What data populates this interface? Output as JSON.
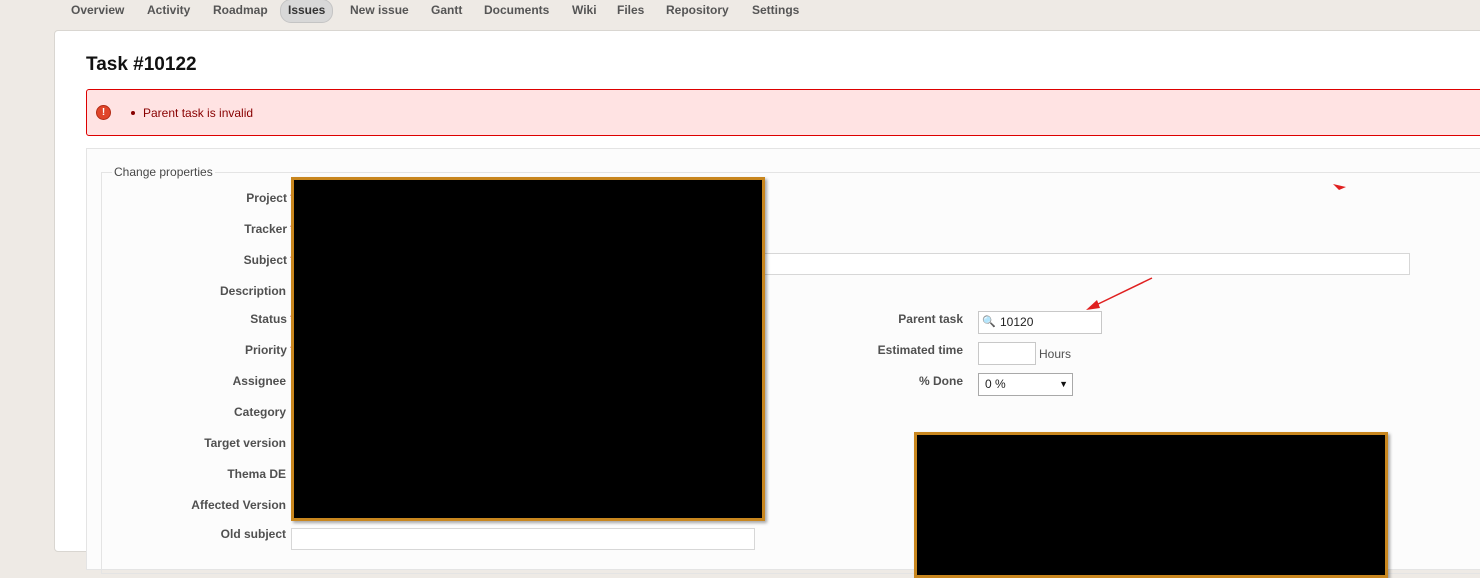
{
  "tabs": [
    {
      "label": "Overview"
    },
    {
      "label": "Activity"
    },
    {
      "label": "Roadmap"
    },
    {
      "label": "Issues"
    },
    {
      "label": "New issue"
    },
    {
      "label": "Gantt"
    },
    {
      "label": "Documents"
    },
    {
      "label": "Wiki"
    },
    {
      "label": "Files"
    },
    {
      "label": "Repository"
    },
    {
      "label": "Settings"
    }
  ],
  "selected_tab": "Issues",
  "page": {
    "title": "Task #10122"
  },
  "error": {
    "message": "Parent task is invalid"
  },
  "form": {
    "legend": "Change properties",
    "required_mark": "*",
    "left_labels": {
      "project": "Project",
      "tracker": "Tracker",
      "subject": "Subject",
      "description": "Description",
      "status": "Status",
      "priority": "Priority",
      "assignee": "Assignee",
      "category": "Category",
      "target_version": "Target version",
      "thema_de": "Thema DE",
      "affected_version": "Affected Version",
      "old_subject": "Old subject"
    },
    "right": {
      "parent_task_label": "Parent task",
      "parent_task_value": "10120",
      "estimated_time_label": "Estimated time",
      "estimated_time_value": "",
      "estimated_time_unit": "Hours",
      "done_label": "% Done",
      "done_value": "0 %"
    }
  },
  "colors": {
    "accent_error_border": "#dd0000",
    "error_bg": "#ffe3e3",
    "redaction_border": "#c8861e",
    "annotation_arrow": "#e02020"
  },
  "icons": {
    "error": "error-circle-icon",
    "search": "magnifier-icon",
    "dropdown": "dropdown-caret-icon"
  }
}
